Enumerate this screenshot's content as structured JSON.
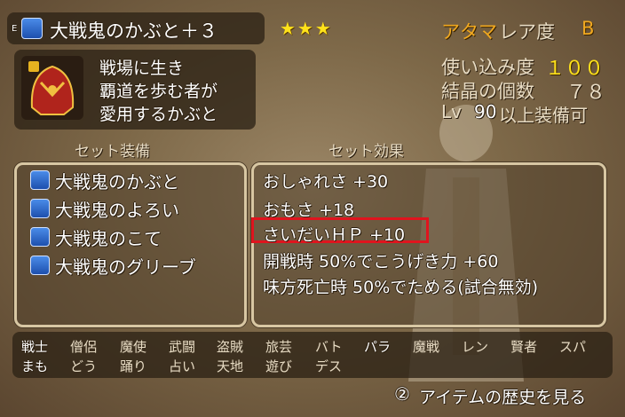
{
  "item": {
    "slot_tag": "E",
    "name": "大戦鬼のかぶと＋３",
    "stars": "★★★",
    "type": "アタマ",
    "rarity_label": "レア度",
    "rarity": "B",
    "description": [
      "戦場に生き",
      "覇道を歩む者が",
      "愛用するかぶと"
    ]
  },
  "stats": {
    "usage_label": "使い込み度",
    "usage": "１００",
    "crystals_label": "結晶の個数",
    "crystals": "７８",
    "lv_label": "Lv",
    "lv": "90",
    "lv_suffix": "以上装備可"
  },
  "set_equipment": {
    "header": "セット装備",
    "items": [
      {
        "label": "大戦鬼のかぶと",
        "icon": "helmet-icon"
      },
      {
        "label": "大戦鬼のよろい",
        "icon": "armor-icon"
      },
      {
        "label": "大戦鬼のこて",
        "icon": "gauntlet-icon"
      },
      {
        "label": "大戦鬼のグリーブ",
        "icon": "greave-icon"
      }
    ]
  },
  "set_effects": {
    "header": "セット効果",
    "items": [
      "おしゃれさ +30",
      "おもさ +18",
      "さいだいＨＰ +10",
      "開戦時 50%でこうげき力 +60",
      "味方死亡時 50%でためる(試合無効)"
    ],
    "highlighted_index": 2,
    "highlight_color": "#e0141e"
  },
  "jobs": {
    "row1": [
      "戦士",
      "僧侶",
      "魔使",
      "武闘",
      "盗賊",
      "旅芸",
      "バト",
      "パラ",
      "魔戦",
      "レン",
      "賢者",
      "スパ"
    ],
    "row2": [
      "まも",
      "どう",
      "踊り",
      "占い",
      "天地",
      "遊び",
      "デス"
    ]
  },
  "footer": {
    "button_glyph": "②",
    "label": "アイテムの歴史を見る"
  }
}
